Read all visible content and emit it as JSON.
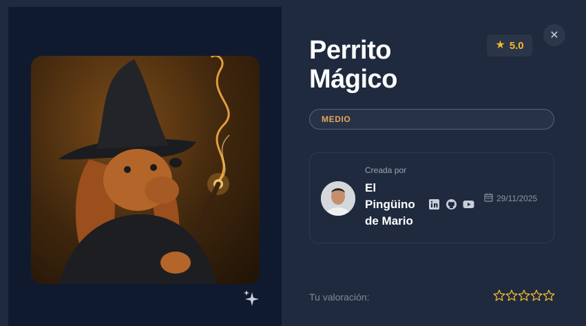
{
  "recipe": {
    "title": "Perrito Mágico",
    "rating": "5.0",
    "difficulty": "MEDIO"
  },
  "author": {
    "created_label": "Creada por",
    "name": "El Pingüino de Mario",
    "date": "29/11/2025"
  },
  "feedback": {
    "your_rating_label": "Tu valoración:",
    "stars_selected": 0,
    "stars_total": 5
  },
  "icons": {
    "close": "close-icon",
    "rating": "star-icon",
    "sparkle": "sparkle-icon",
    "socials": [
      "linkedin-icon",
      "github-icon",
      "youtube-icon"
    ],
    "date": "calendar-icon"
  },
  "colors": {
    "background": "#1f2a3e",
    "image_panel": "#101a2e",
    "accent_gold": "#f5b82e",
    "difficulty_text": "#e7a65a"
  }
}
